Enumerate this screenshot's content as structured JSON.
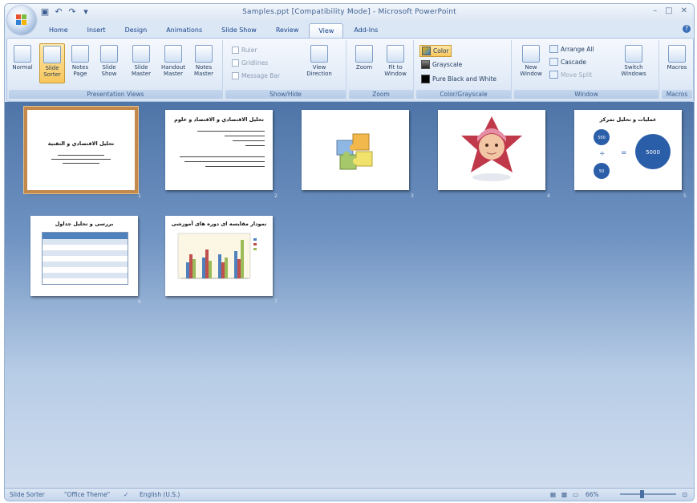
{
  "window": {
    "title": "Samples.ppt [Compatibility Mode] - Microsoft PowerPoint",
    "controls": [
      "minimize",
      "maximize",
      "close"
    ]
  },
  "quick_access": {
    "icons": [
      "save-icon",
      "undo-icon",
      "redo-icon",
      "customize-icon"
    ]
  },
  "tabs": [
    "Home",
    "Insert",
    "Design",
    "Animations",
    "Slide Show",
    "Review",
    "View",
    "Add-Ins"
  ],
  "active_tab": "View",
  "ribbon": {
    "presentation_views": {
      "label": "Presentation Views",
      "buttons": [
        "Normal",
        "Slide Sorter",
        "Notes Page",
        "Slide Show",
        "Slide Master",
        "Handout Master",
        "Notes Master"
      ]
    },
    "show_hide": {
      "label": "Show/Hide",
      "checks": [
        "Ruler",
        "Gridlines",
        "Message Bar"
      ],
      "button": "View Direction"
    },
    "zoom": {
      "label": "Zoom",
      "buttons": [
        "Zoom",
        "Fit to Window"
      ]
    },
    "color_grayscale": {
      "label": "Color/Grayscale",
      "options": [
        "Color",
        "Grayscale",
        "Pure Black and White"
      ],
      "selected": "Color"
    },
    "window": {
      "label": "Window",
      "big": "New Window",
      "small": [
        "Arrange All",
        "Cascade",
        "Move Split"
      ],
      "switch": "Switch Windows"
    },
    "macros": {
      "label": "Macros",
      "button": "Macros"
    }
  },
  "slides": [
    {
      "num": "1",
      "title": "تحليل الاقتصادي و التقنية",
      "kind": "text-title"
    },
    {
      "num": "2",
      "title": "تحليل الاقتصادي و الاقتصاد و علوم",
      "kind": "text-bullets"
    },
    {
      "num": "3",
      "title": "",
      "kind": "puzzle"
    },
    {
      "num": "4",
      "title": "",
      "kind": "photo"
    },
    {
      "num": "5",
      "title": "عملیات و تحليل تمرکز",
      "kind": "diagram",
      "circles": [
        "5000",
        "500",
        "50"
      ]
    },
    {
      "num": "6",
      "title": "بررسی و تحليل جداول",
      "kind": "table"
    },
    {
      "num": "7",
      "title": "نمودار مقایسه ای دوره های آموزشی",
      "kind": "chart"
    }
  ],
  "statusbar": {
    "view": "Slide Sorter",
    "theme": "\"Office Theme\"",
    "language": "English (U.S.)",
    "zoom": "66%"
  }
}
